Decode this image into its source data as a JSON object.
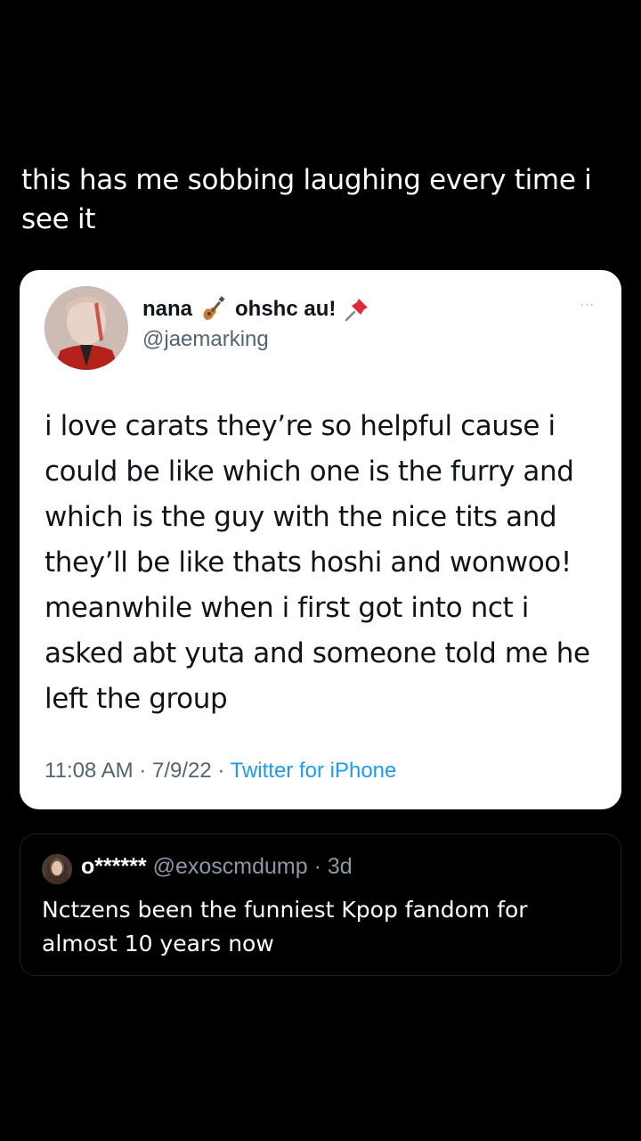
{
  "post": {
    "caption": "this has me sobbing laughing every time i see it"
  },
  "tweet": {
    "author_name_part1": "nana",
    "author_name_part2": "ohshc au!",
    "emoji_1": "guitar-icon",
    "emoji_2": "pushpin-icon",
    "handle": "@jaemarking",
    "more": "···",
    "text": "i love carats they’re so helpful cause i could be like which one is the furry and which is the guy with the nice tits and they’ll be like thats hoshi and wonwoo! meanwhile when i first got into nct i asked abt yuta and someone told me he left the group",
    "time": "11:08 AM",
    "date": "7/9/22",
    "separator": "·",
    "source": "Twitter for iPhone"
  },
  "reply": {
    "name": "o******",
    "handle": "@exoscmdump",
    "age": "3d",
    "separator": "·",
    "text": "Nctzens been the funniest Kpop fandom for almost 10 years now"
  },
  "colors": {
    "background": "#000000",
    "card": "#ffffff",
    "link": "#1d9bf0",
    "muted": "#536471"
  }
}
